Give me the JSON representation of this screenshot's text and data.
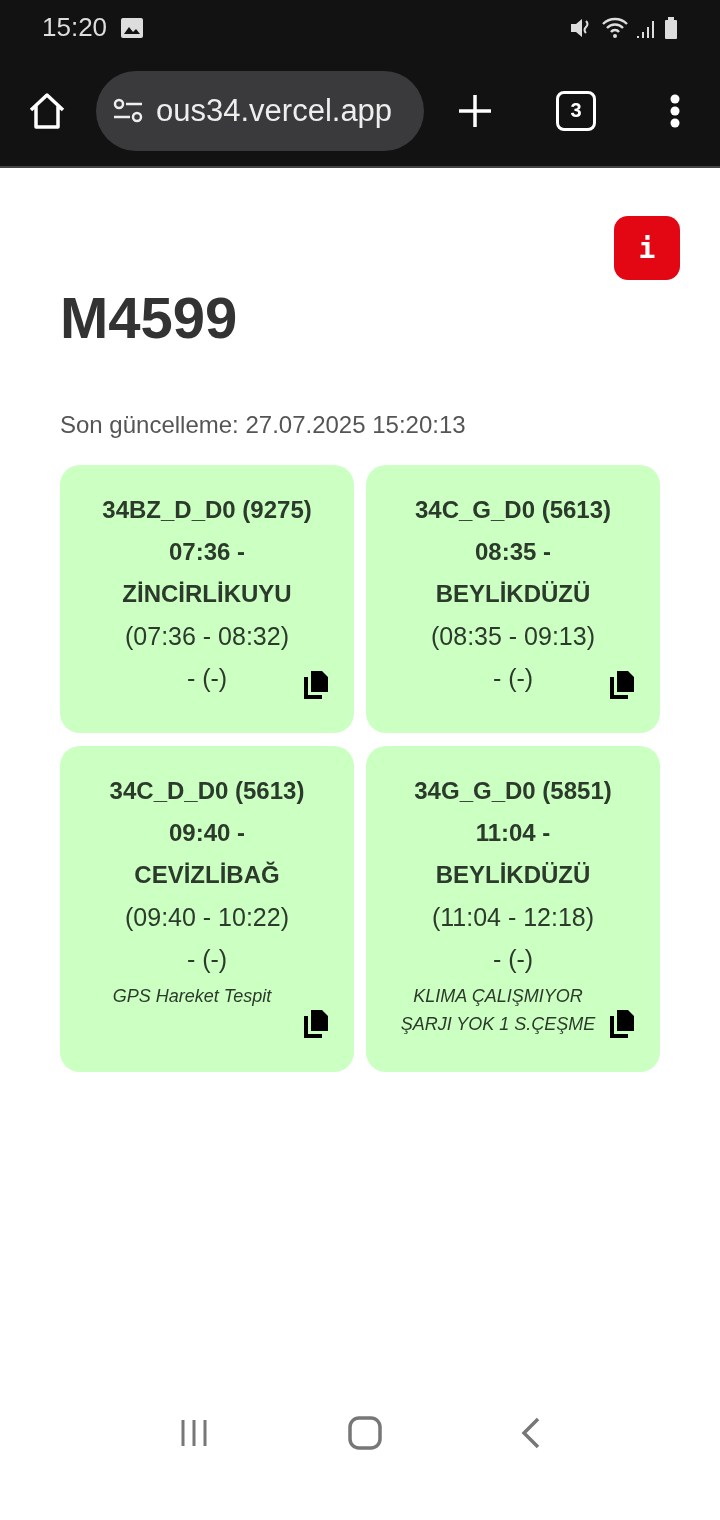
{
  "status_bar": {
    "time": "15:20"
  },
  "browser": {
    "url": "ous34.vercel.app",
    "tab_count": "3"
  },
  "page": {
    "info_button": "i",
    "title": "M4599",
    "updated": "Son güncelleme: 27.07.2025 15:20:13",
    "cards": [
      {
        "code": "34BZ_D_D0 (9275)",
        "departure": "07:36 -",
        "destination": "ZİNCİRLİKUYU",
        "span": "(07:36 - 08:32)",
        "extra": "- (-)"
      },
      {
        "code": "34C_G_D0 (5613)",
        "departure": "08:35 -",
        "destination": "BEYLİKDÜZÜ",
        "span": "(08:35 - 09:13)",
        "extra": "- (-)"
      },
      {
        "code": "34C_D_D0 (5613)",
        "departure": "09:40 -",
        "destination": "CEVİZLİBAĞ",
        "span": "(09:40 - 10:22)",
        "extra": "- (-)",
        "note": "GPS Hareket Tespit"
      },
      {
        "code": "34G_G_D0 (5851)",
        "departure": "11:04 -",
        "destination": "BEYLİKDÜZÜ",
        "span": "(11:04 - 12:18)",
        "extra": "- (-)",
        "note": "KLIMA ÇALIŞMIYOR ŞARJI YOK 1 S.ÇEŞME"
      }
    ]
  }
}
